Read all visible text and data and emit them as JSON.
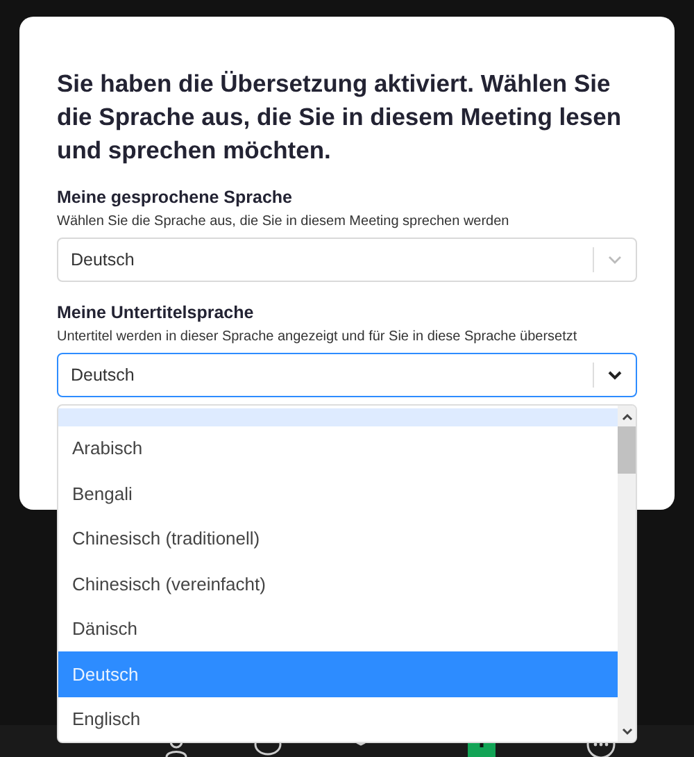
{
  "dialog": {
    "title": "Sie haben die Übersetzung aktiviert. Wählen Sie die Sprache aus, die Sie in diesem Meeting lesen und sprechen möchten.",
    "fields": [
      {
        "label": "Meine gesprochene Sprache",
        "hint": "Wählen Sie die Sprache aus, die Sie in diesem Meeting sprechen werden",
        "value": "Deutsch",
        "open": false
      },
      {
        "label": "Meine Untertitelsprache",
        "hint": "Untertitel werden in dieser Sprache angezeigt und für Sie in diese Sprache übersetzt",
        "value": "Deutsch",
        "open": true
      }
    ]
  },
  "dropdown": {
    "options": [
      {
        "label": "Arabisch",
        "selected": false
      },
      {
        "label": "Bengali",
        "selected": false
      },
      {
        "label": "Chinesisch (traditionell)",
        "selected": false
      },
      {
        "label": "Chinesisch (vereinfacht)",
        "selected": false
      },
      {
        "label": "Dänisch",
        "selected": false
      },
      {
        "label": "Deutsch",
        "selected": true
      },
      {
        "label": "Englisch",
        "selected": false
      }
    ]
  }
}
